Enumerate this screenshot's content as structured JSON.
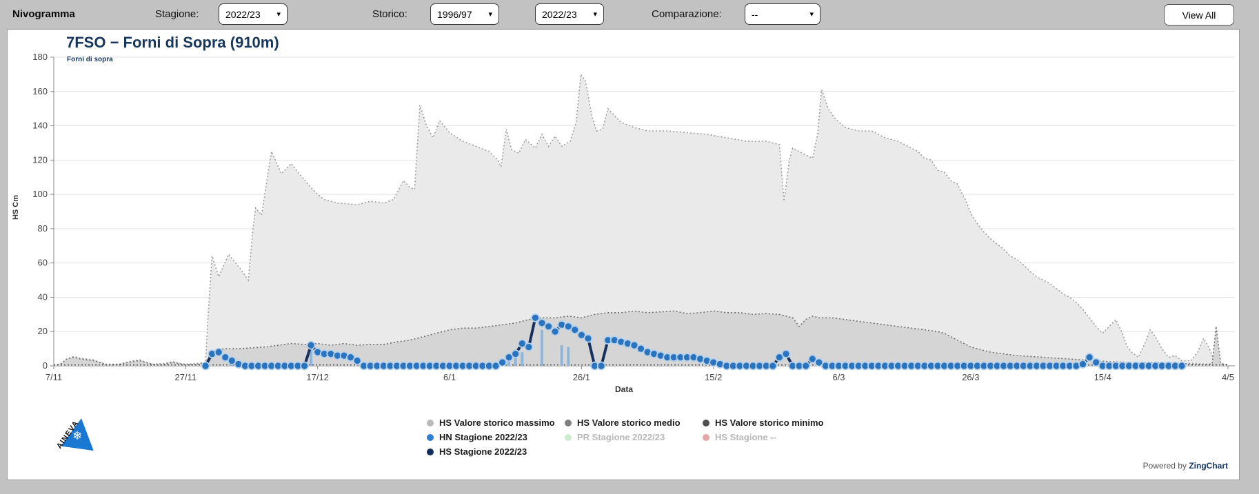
{
  "topbar": {
    "title": "Nivogramma",
    "stagione_label": "Stagione:",
    "stagione_value": "2022/23",
    "storico_label": "Storico:",
    "storico_value1": "1996/97",
    "storico_value2": "2022/23",
    "comparazione_label": "Comparazione:",
    "comparazione_value": "--",
    "view_all_label": "View All",
    "caret": "▾"
  },
  "header": {
    "title": "7FSO − Forni di Sopra (910m)",
    "subtitle": "Forni di sopra"
  },
  "footer": {
    "powered": "Powered by",
    "brand": "ZingChart"
  },
  "logo": {
    "word": "AINEVA",
    "flake": "❄"
  },
  "legend": {
    "items": [
      {
        "label": "HS Valore storico massimo",
        "color": "#b9b9b9",
        "muted": false
      },
      {
        "label": "HS Valore storico medio",
        "color": "#7f7f7f",
        "muted": false
      },
      {
        "label": "HS Valore storico minimo",
        "color": "#4d4d4d",
        "muted": false
      },
      {
        "label": "HN Stagione 2022/23",
        "color": "#2d7dd2",
        "muted": false
      },
      {
        "label": "PR Stagione 2022/23",
        "color": "#cdeccd",
        "muted": true
      },
      {
        "label": "HS Stagione --",
        "color": "#e2a6a6",
        "muted": true
      },
      {
        "label": "HS Stagione 2022/23",
        "color": "#122e5e",
        "muted": false
      }
    ]
  },
  "chart_data": {
    "type": "mixed",
    "title": "7FSO − Forni di Sopra (910m)",
    "x_axis": {
      "title": "Data",
      "tick_labels": [
        "7/11",
        "27/11",
        "17/12",
        "6/1",
        "26/1",
        "15/2",
        "6/3",
        "26/3",
        "15/4",
        "4/5"
      ],
      "tick_days": [
        0,
        20,
        40,
        60,
        80,
        100,
        119,
        139,
        159,
        178
      ],
      "days_total": 178,
      "grid": false
    },
    "y_axis": {
      "title": "HS Cm",
      "min": 0,
      "max": 180,
      "step": 20,
      "grid": true
    },
    "series": [
      {
        "name": "HS Valore storico massimo",
        "type": "area",
        "fill": "#eaeaea",
        "line": "#9c9c9c",
        "points": [
          [
            0,
            0
          ],
          [
            1,
            1
          ],
          [
            2,
            4
          ],
          [
            3,
            5.5
          ],
          [
            4,
            4.5
          ],
          [
            5,
            4
          ],
          [
            6,
            3.5
          ],
          [
            7,
            2
          ],
          [
            8,
            1
          ],
          [
            10,
            1
          ],
          [
            12,
            3
          ],
          [
            13,
            3.5
          ],
          [
            14,
            2
          ],
          [
            15,
            1
          ],
          [
            17,
            1.5
          ],
          [
            18,
            2.5
          ],
          [
            19,
            1.5
          ],
          [
            20,
            1
          ],
          [
            22,
            1.5
          ],
          [
            23,
            2
          ],
          [
            23.4,
            30
          ],
          [
            24,
            64
          ],
          [
            25,
            52
          ],
          [
            26.5,
            65
          ],
          [
            28,
            58
          ],
          [
            29.5,
            50
          ],
          [
            30.2,
            80
          ],
          [
            30.6,
            92
          ],
          [
            31.5,
            88
          ],
          [
            33,
            125
          ],
          [
            34.5,
            112
          ],
          [
            36,
            118
          ],
          [
            37,
            113
          ],
          [
            39,
            104
          ],
          [
            40,
            100
          ],
          [
            41,
            97
          ],
          [
            43,
            95
          ],
          [
            46,
            94
          ],
          [
            48,
            96
          ],
          [
            50,
            95
          ],
          [
            51.5,
            97
          ],
          [
            53,
            108
          ],
          [
            54,
            104
          ],
          [
            54.7,
            103
          ],
          [
            55.5,
            152
          ],
          [
            56.5,
            140
          ],
          [
            57.5,
            133
          ],
          [
            58.5,
            143
          ],
          [
            60,
            136
          ],
          [
            62,
            131
          ],
          [
            64,
            128
          ],
          [
            66,
            125
          ],
          [
            67.3,
            120
          ],
          [
            67.8,
            116
          ],
          [
            68.6,
            138
          ],
          [
            69.4,
            126
          ],
          [
            70.5,
            124
          ],
          [
            71.5,
            132
          ],
          [
            73,
            127
          ],
          [
            74,
            135
          ],
          [
            75,
            128
          ],
          [
            76,
            134
          ],
          [
            77,
            128
          ],
          [
            78.3,
            131
          ],
          [
            79.2,
            142
          ],
          [
            79.9,
            170
          ],
          [
            80.6,
            166
          ],
          [
            81.6,
            145
          ],
          [
            82.3,
            137
          ],
          [
            83.2,
            138
          ],
          [
            84,
            150
          ],
          [
            85,
            146
          ],
          [
            86,
            142
          ],
          [
            88,
            139
          ],
          [
            90,
            137
          ],
          [
            93,
            137
          ],
          [
            96,
            136
          ],
          [
            99,
            135
          ],
          [
            102,
            133
          ],
          [
            105,
            131
          ],
          [
            108,
            131
          ],
          [
            110,
            129
          ],
          [
            110.7,
            96
          ],
          [
            111.5,
            120
          ],
          [
            112,
            127
          ],
          [
            113.5,
            124
          ],
          [
            115,
            121
          ],
          [
            115.8,
            135
          ],
          [
            116.4,
            161
          ],
          [
            117.4,
            150
          ],
          [
            118.5,
            144
          ],
          [
            120,
            139
          ],
          [
            122,
            137
          ],
          [
            124,
            137
          ],
          [
            126,
            133
          ],
          [
            128,
            131
          ],
          [
            130,
            127
          ],
          [
            131,
            125
          ],
          [
            132,
            121
          ],
          [
            133,
            120
          ],
          [
            134,
            114
          ],
          [
            135,
            113
          ],
          [
            136,
            108
          ],
          [
            137,
            106
          ],
          [
            137.6,
            101
          ],
          [
            138.2,
            97
          ],
          [
            139,
            89
          ],
          [
            140,
            83
          ],
          [
            141,
            78
          ],
          [
            142,
            74
          ],
          [
            143,
            71
          ],
          [
            144,
            68
          ],
          [
            145,
            64
          ],
          [
            146,
            62
          ],
          [
            147,
            59
          ],
          [
            148,
            55
          ],
          [
            149,
            52
          ],
          [
            150,
            50
          ],
          [
            151,
            48
          ],
          [
            152,
            45
          ],
          [
            153,
            42
          ],
          [
            154,
            40
          ],
          [
            155,
            37
          ],
          [
            156,
            33
          ],
          [
            157,
            28
          ],
          [
            158,
            23
          ],
          [
            159,
            19
          ],
          [
            160,
            23
          ],
          [
            161,
            27
          ],
          [
            162,
            19
          ],
          [
            162.6,
            12
          ],
          [
            163.4,
            8
          ],
          [
            164.4,
            5
          ],
          [
            165.4,
            13
          ],
          [
            166.2,
            21
          ],
          [
            167,
            17
          ],
          [
            168,
            10
          ],
          [
            169,
            5
          ],
          [
            170,
            6
          ],
          [
            171,
            3
          ],
          [
            172.4,
            3
          ],
          [
            173.4,
            8
          ],
          [
            174.3,
            16
          ],
          [
            175.2,
            10
          ],
          [
            175.7,
            5
          ],
          [
            176.3,
            2
          ],
          [
            177,
            1
          ],
          [
            178,
            0
          ]
        ]
      },
      {
        "name": "HS Valore storico medio",
        "type": "area",
        "fill": "#d5d5d5",
        "line": "#6e6e6e",
        "points": [
          [
            0,
            0.5
          ],
          [
            1,
            1
          ],
          [
            2,
            4
          ],
          [
            3,
            5
          ],
          [
            4,
            4
          ],
          [
            5,
            3.5
          ],
          [
            6,
            3
          ],
          [
            7,
            2
          ],
          [
            8,
            0.5
          ],
          [
            10,
            1
          ],
          [
            12,
            2.5
          ],
          [
            13,
            3
          ],
          [
            14,
            2
          ],
          [
            15,
            0.8
          ],
          [
            16,
            0.5
          ],
          [
            17,
            1
          ],
          [
            18,
            2
          ],
          [
            19,
            1.2
          ],
          [
            20,
            0.6
          ],
          [
            22,
            1
          ],
          [
            23,
            2
          ],
          [
            24,
            8
          ],
          [
            25,
            9.5
          ],
          [
            26,
            10
          ],
          [
            28,
            10
          ],
          [
            30,
            10.5
          ],
          [
            32,
            11
          ],
          [
            34,
            12
          ],
          [
            36,
            13
          ],
          [
            38,
            12.5
          ],
          [
            40,
            13
          ],
          [
            42,
            12
          ],
          [
            44,
            13
          ],
          [
            46,
            12
          ],
          [
            48,
            12.5
          ],
          [
            50,
            12.5
          ],
          [
            52,
            14
          ],
          [
            54,
            15
          ],
          [
            56,
            17
          ],
          [
            58,
            19
          ],
          [
            60,
            21
          ],
          [
            62,
            22
          ],
          [
            64,
            22
          ],
          [
            66,
            23
          ],
          [
            68,
            24
          ],
          [
            70,
            25
          ],
          [
            72,
            27
          ],
          [
            74,
            28
          ],
          [
            76,
            28
          ],
          [
            78,
            29
          ],
          [
            80,
            28
          ],
          [
            82,
            30
          ],
          [
            84,
            31
          ],
          [
            86,
            31
          ],
          [
            88,
            32
          ],
          [
            90,
            31
          ],
          [
            92,
            31.5
          ],
          [
            94,
            32
          ],
          [
            96,
            30.5
          ],
          [
            98,
            31
          ],
          [
            100,
            32
          ],
          [
            102,
            31
          ],
          [
            104,
            31
          ],
          [
            106,
            30
          ],
          [
            108,
            30.5
          ],
          [
            110,
            30
          ],
          [
            112,
            28
          ],
          [
            113,
            23
          ],
          [
            114,
            27
          ],
          [
            115,
            29
          ],
          [
            116,
            28
          ],
          [
            118,
            28
          ],
          [
            120,
            27
          ],
          [
            122,
            26
          ],
          [
            124,
            25
          ],
          [
            126,
            24
          ],
          [
            128,
            23
          ],
          [
            130,
            22
          ],
          [
            132,
            21
          ],
          [
            134,
            20
          ],
          [
            135,
            19
          ],
          [
            136,
            17
          ],
          [
            137,
            15
          ],
          [
            138,
            13
          ],
          [
            139,
            11
          ],
          [
            140,
            10
          ],
          [
            141,
            9
          ],
          [
            142,
            8
          ],
          [
            144,
            7
          ],
          [
            146,
            6
          ],
          [
            148,
            5.5
          ],
          [
            150,
            5
          ],
          [
            152,
            4.5
          ],
          [
            154,
            4
          ],
          [
            156,
            3.5
          ],
          [
            158,
            3
          ],
          [
            160,
            2.5
          ],
          [
            163,
            2
          ],
          [
            166,
            2
          ],
          [
            170,
            1.5
          ],
          [
            174,
            1
          ],
          [
            175.6,
            1
          ],
          [
            176.2,
            23
          ],
          [
            176.9,
            1.5
          ],
          [
            178,
            0.5
          ]
        ]
      },
      {
        "name": "HS Valore storico minimo",
        "type": "line",
        "line": "#4a4a4a",
        "points": [
          [
            0,
            0.5
          ],
          [
            178,
            0.5
          ]
        ]
      },
      {
        "name": "HN Stagione 2022/23 (barre)",
        "type": "bar",
        "fill": "#8fb6da",
        "points": [
          [
            27,
            3
          ],
          [
            39,
            12
          ],
          [
            69,
            4
          ],
          [
            70,
            5
          ],
          [
            71,
            8
          ],
          [
            74,
            21
          ],
          [
            77,
            12
          ],
          [
            78,
            11
          ]
        ]
      },
      {
        "name": "HS Stagione 2022/23",
        "type": "line_markers",
        "line": "#15315e",
        "marker_fill": "#2a73bf",
        "marker_stroke": "#b5d1eb",
        "start_day": 23,
        "values": [
          0,
          7,
          8,
          5,
          3,
          1,
          0,
          0,
          0,
          0,
          0,
          0,
          0,
          0,
          0,
          0,
          12,
          8,
          7,
          7,
          6,
          6,
          5,
          3,
          0,
          0,
          0,
          0,
          0,
          0,
          0,
          0,
          0,
          0,
          0,
          0,
          0,
          0,
          0,
          0,
          0,
          0,
          0,
          0,
          0,
          2,
          5,
          7,
          13,
          11,
          28,
          25,
          23,
          20,
          24,
          23,
          21,
          18,
          16,
          0,
          0,
          15,
          15,
          14,
          13,
          12,
          10,
          8,
          7,
          6,
          5,
          5,
          5,
          5,
          5,
          4,
          3,
          2,
          1,
          0,
          0,
          0,
          0,
          0,
          0,
          0,
          0,
          5,
          7,
          0,
          0,
          0,
          4,
          2,
          0,
          0,
          0,
          0,
          0,
          0,
          0,
          0,
          0,
          0,
          0,
          0,
          0,
          0,
          0,
          0,
          0,
          0,
          0,
          0,
          0,
          0,
          0,
          0,
          0,
          0,
          0,
          0,
          0,
          0,
          0,
          0,
          0,
          0,
          0,
          0,
          0,
          0,
          0,
          1,
          5,
          2,
          0,
          0,
          0,
          0,
          0,
          0,
          0,
          0,
          0,
          0,
          0,
          0,
          0
        ]
      }
    ]
  }
}
